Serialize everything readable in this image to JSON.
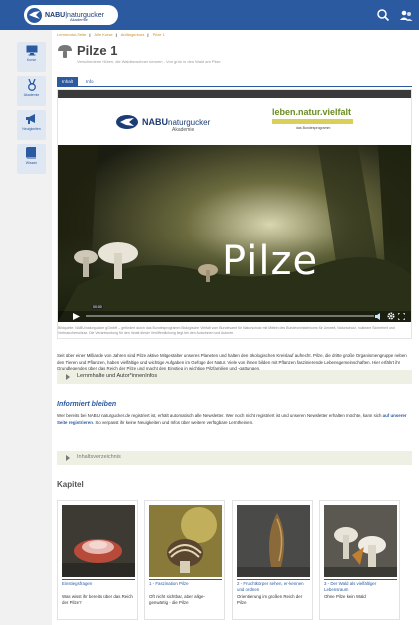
{
  "header": {
    "logo_text_1": "NABU",
    "logo_text_2": "|naturgucker",
    "logo_text_3": "Akademie"
  },
  "sidebar": {
    "items": [
      {
        "label": "Kurse",
        "icon": "monitor-icon"
      },
      {
        "label": "Akademie",
        "icon": "award-icon"
      },
      {
        "label": "Neuigkeiten",
        "icon": "megaphone-icon"
      },
      {
        "label": "Wissen",
        "icon": "book-icon"
      }
    ]
  },
  "breadcrumb": {
    "items": [
      "Lernmodul-Seite",
      "Alle Kurse",
      "Anfängerkurs",
      "Pilze 1"
    ]
  },
  "page": {
    "title": "Pilze 1",
    "subtitle": "Verschiedene Hüten, die Waldbewohner kennen - Von grün in den Wald am Pilze"
  },
  "tabs": [
    {
      "label": "Inhalt",
      "active": true
    },
    {
      "label": "Info",
      "active": false
    }
  ],
  "hero": {
    "nabu_brand": "NABU",
    "nabu_brand2": "naturgucker",
    "nabu_sub": "Akademie",
    "lnv_title": "leben.natur.vielfalt",
    "lnv_sub": "das Bundesprogramm"
  },
  "video": {
    "title": "Pilze",
    "time": "00:00",
    "caption": "Bildquelle: NABU/naturgucker gGmbH – gefördert durch das Bundesprogramm Biologische Vielfalt vom Bundesamt für Naturschutz mit Mitteln des Bundesministeriums für Umwelt, Naturschutz, nukleare Sicherheit und Verbraucherschutz. Die Verantwortung für den Inhalt dieser Veröffentlichung liegt bei den Autorinnen und Autoren."
  },
  "description": "Seit über einer Milliarde von Jahren sind Pilze aktive Mitgestalter unseres Planeten und halten den ökologischen Kreislauf aufrecht. Pilze, die dritte große Organismengruppe neben den Tieren und Pflanzen, haben vielfältige und wichtige Aufgaben im Gefüge der Natur. Viele von ihnen bilden mit Pflanzen faszinierende Lebensgemeinschaften. Hier erfährt ihr Grundlegendes über das Reich der Pilze und macht den Einstieg in wichtige Pilzfamilien und -gattungen.",
  "accordion_1": "Lernmhalte und Autor*innenInfos",
  "info": {
    "heading": "Informiert bleiben",
    "text_1": "Wer bereits bei NABU naturgucker.de registriert ist, erhält automatisch alle Newsletter. Wer noch nicht registriert ist und unseren Newsletter erhalten möchte, kann sich",
    "link": "auf unserer Seite registrieren",
    "text_2": ". So verpasst ihr keine Neuigkeiten und Infos über weitere verfügbare Lerntheinen."
  },
  "accordion_2": "Inhaltsverzeichnis",
  "kapitel": {
    "heading": "Kapitel",
    "cards": [
      {
        "title": "Einstiegsfragen",
        "desc": "Was wisst ihr bereits über das Reich der Pilze?"
      },
      {
        "title": "1 - Faszination Pilze",
        "desc": "Oft nicht sichtbar, aber allge-genwärtig - die Pilze"
      },
      {
        "title": "2 - Fruchtkörper sehen, er-kennen und ordnen",
        "desc": "Orientierung im großen Reich der Pilze"
      },
      {
        "title": "3 - Der Wald als vielfältiger Lebensraum",
        "desc": "Ohne Pilze kein Wald"
      }
    ]
  },
  "colors": {
    "brand_blue": "#2c5aa0",
    "accent_orange": "#c8902a",
    "accordion_bg": "#eef0e4"
  }
}
